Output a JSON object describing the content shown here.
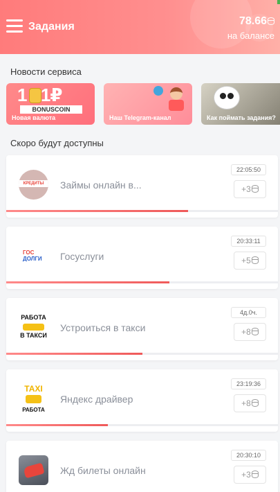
{
  "header": {
    "title": "Задания",
    "balance_amount": "78.66",
    "balance_label": "на балансе",
    "accent_colors": [
      "#ff7b7b",
      "#ffb0a8"
    ]
  },
  "news": {
    "title": "Новости сервиса",
    "cards": [
      {
        "caption": "Новая валюта",
        "big_text": "1 =1₽",
        "label": "BONUSCOIN"
      },
      {
        "caption": "Наш Telegram-канал",
        "icon": "telegram-icon"
      },
      {
        "caption": "Как поймать задания?"
      }
    ]
  },
  "upcoming": {
    "title": "Скоро будут доступны",
    "tasks": [
      {
        "name": "Займы онлайн в...",
        "timer": "22:05:50",
        "reward": "+3",
        "progress": 0.67,
        "logo_text": "КРЕДИТЫ"
      },
      {
        "name": "Госуслуги",
        "timer": "20:33:11",
        "reward": "+5",
        "progress": 0.6,
        "logo_text_1": "ГОС",
        "logo_text_2": "ДОЛГИ"
      },
      {
        "name": "Устроиться в такси",
        "timer": "4д.0ч.",
        "reward": "+8",
        "progress": 0.5,
        "logo_text_1": "РАБОТА",
        "logo_text_2": "В ТАКСИ"
      },
      {
        "name": "Яндекс драйвер",
        "timer": "23:19:36",
        "reward": "+8",
        "progress": 0.375,
        "logo_text_1": "TAXI",
        "logo_text_2": "РАБОТА"
      },
      {
        "name": "Жд билеты онлайн",
        "timer": "20:30:10",
        "reward": "+3",
        "progress": 0.0
      }
    ]
  }
}
